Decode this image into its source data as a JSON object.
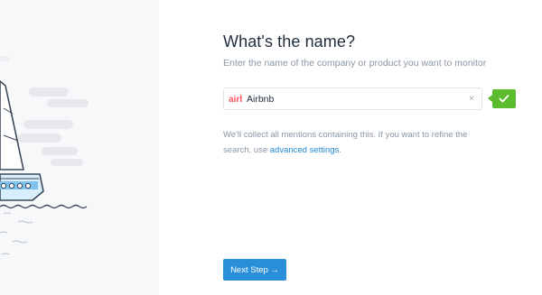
{
  "header": {
    "title": "What's the name?",
    "subtitle": "Enter the name of the company or product you want to monitor"
  },
  "company_field": {
    "value": "Airbnb",
    "logo_icon": "airbnb-logo-icon",
    "clear_icon": "close-icon",
    "clear_label": "×",
    "valid_icon": "checkmark-icon",
    "valid_color": "#5cbc2f"
  },
  "helper": {
    "text_before": "We'll collect all mentions containing this. If you want to refine the search, use ",
    "link_label": "advanced settings",
    "text_after": "."
  },
  "footer": {
    "next_label": "Next Step →"
  },
  "colors": {
    "accent": "#2a8fd9",
    "link": "#1f8ad6",
    "success": "#5cbc2f",
    "panel_bg": "#f7f8fa"
  }
}
